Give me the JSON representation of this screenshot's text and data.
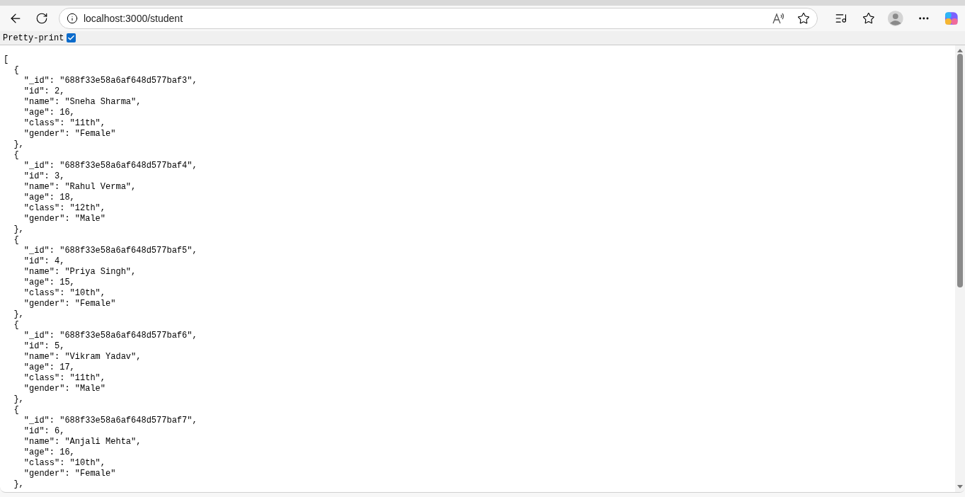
{
  "address_bar": {
    "url": "localhost:3000/student"
  },
  "pretty_print": {
    "label": "Pretty-print",
    "checked": true
  },
  "json_lines": [
    "[",
    "  {",
    "    \"_id\": \"688f33e58a6af648d577baf3\",",
    "    \"id\": 2,",
    "    \"name\": \"Sneha Sharma\",",
    "    \"age\": 16,",
    "    \"class\": \"11th\",",
    "    \"gender\": \"Female\"",
    "  },",
    "  {",
    "    \"_id\": \"688f33e58a6af648d577baf4\",",
    "    \"id\": 3,",
    "    \"name\": \"Rahul Verma\",",
    "    \"age\": 18,",
    "    \"class\": \"12th\",",
    "    \"gender\": \"Male\"",
    "  },",
    "  {",
    "    \"_id\": \"688f33e58a6af648d577baf5\",",
    "    \"id\": 4,",
    "    \"name\": \"Priya Singh\",",
    "    \"age\": 15,",
    "    \"class\": \"10th\",",
    "    \"gender\": \"Female\"",
    "  },",
    "  {",
    "    \"_id\": \"688f33e58a6af648d577baf6\",",
    "    \"id\": 5,",
    "    \"name\": \"Vikram Yadav\",",
    "    \"age\": 17,",
    "    \"class\": \"11th\",",
    "    \"gender\": \"Male\"",
    "  },",
    "  {",
    "    \"_id\": \"688f33e58a6af648d577baf7\",",
    "    \"id\": 6,",
    "    \"name\": \"Anjali Mehta\",",
    "    \"age\": 16,",
    "    \"class\": \"10th\",",
    "    \"gender\": \"Female\"",
    "  },"
  ]
}
